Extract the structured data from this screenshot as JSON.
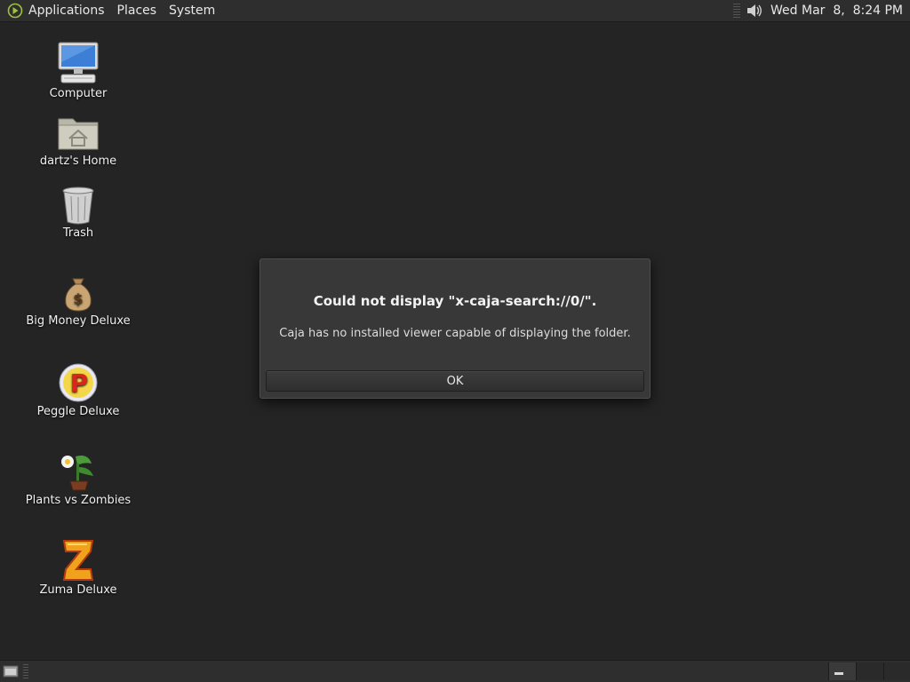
{
  "top_panel": {
    "menus": [
      "Applications",
      "Places",
      "System"
    ],
    "clock": "Wed Mar  8,  8:24 PM",
    "volume_icon": "speaker-icon"
  },
  "desktop": {
    "icons": [
      {
        "label": "Computer",
        "icon": "computer-icon"
      },
      {
        "label": "dartz's Home",
        "icon": "home-folder-icon"
      },
      {
        "label": "Trash",
        "icon": "trash-icon"
      },
      {
        "label": "Big Money Deluxe",
        "icon": "money-bag-icon"
      },
      {
        "label": "Peggle Deluxe",
        "icon": "peggle-icon"
      },
      {
        "label": "Plants vs Zombies",
        "icon": "plants-icon"
      },
      {
        "label": "Zuma Deluxe",
        "icon": "zuma-icon"
      }
    ]
  },
  "dialog": {
    "title": "Could not display \"x-caja-search://0/\".",
    "message": "Caja has no installed viewer capable of displaying the folder.",
    "ok_label": "OK"
  },
  "colors": {
    "desktop_bg": "#242424",
    "panel_bg": "#2e2e2e",
    "dialog_bg": "#383838"
  }
}
